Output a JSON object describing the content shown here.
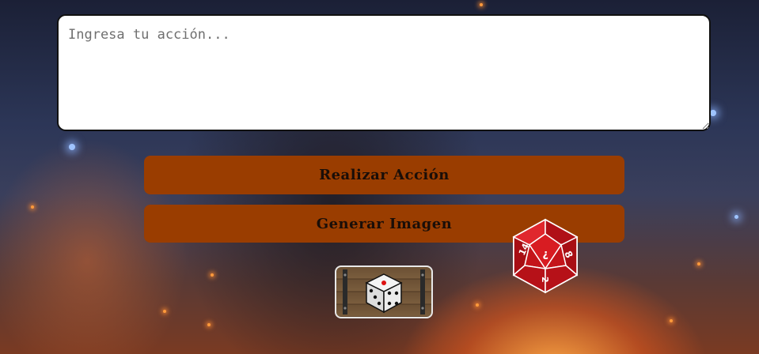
{
  "action_input": {
    "placeholder": "Ingresa tu acción...",
    "value": ""
  },
  "buttons": {
    "perform_action": "Realizar Acción",
    "generate_image": "Generar Imagen"
  },
  "icons": {
    "chest_dice": "dice-chest-icon",
    "d20": "d20-icon"
  },
  "d20_faces": {
    "top_left": "14",
    "top_right": "8",
    "center": "?",
    "bottom": "2"
  },
  "colors": {
    "button_bg": "#9a3d00",
    "button_text": "#1a0e08",
    "d20_red": "#c8161c",
    "input_border": "#111111"
  }
}
